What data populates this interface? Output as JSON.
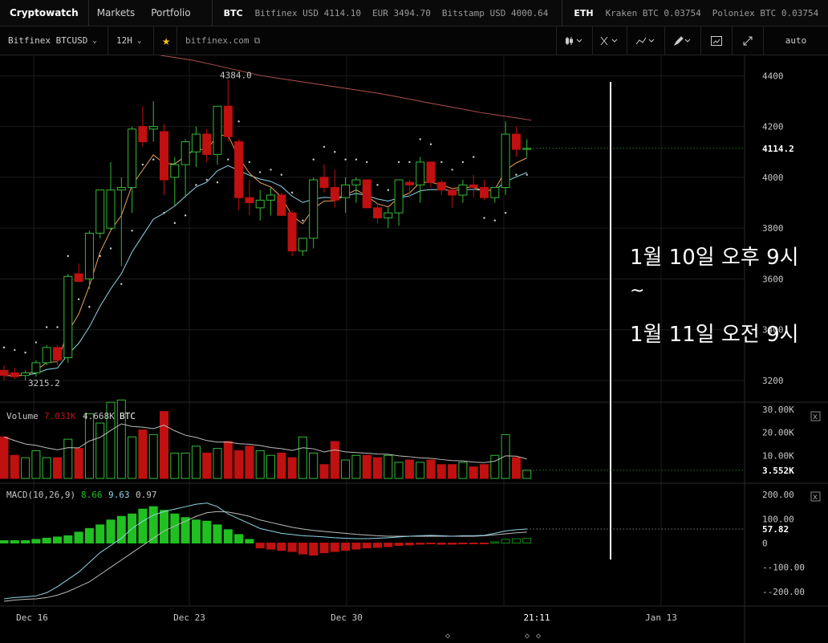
{
  "app": {
    "name": "Cryptowatch"
  },
  "nav": [
    "Markets",
    "Portfolio"
  ],
  "ticker": {
    "btc": {
      "label": "BTC",
      "items": [
        "Bitfinex USD 4114.10",
        "EUR 3494.70",
        "Bitstamp USD 4000.64"
      ]
    },
    "eth": {
      "label": "ETH",
      "items": [
        "Kraken BTC 0.03754",
        "Poloniex BTC 0.03754"
      ]
    }
  },
  "toolbar": {
    "market": "Bitfinex BTCUSD",
    "period": "12H",
    "star_icon": "star-icon",
    "link": "bitfinex.com",
    "icons": [
      "candlestick-icon",
      "crosshair-icon",
      "line-icon",
      "pencil-icon",
      "screenshot-icon",
      "fullscreen-icon"
    ],
    "scale": "auto"
  },
  "overlay": {
    "line1": "1월 10일 오후 9시",
    "line2": "~",
    "line3": "1월 11일 오전 9시"
  },
  "colors": {
    "up": "#35b935",
    "down": "#c01010",
    "ema_fast": "#e8a060",
    "ema_slow": "#8fd6e6",
    "sma": "#b05050",
    "dot": "#cfcfcf",
    "macd_up": "#20c020"
  },
  "chart_data": {
    "type": "candlestick",
    "market": "Bitfinex BTCUSD",
    "interval": "12H",
    "price_axis": {
      "ticks": [
        3200,
        3400,
        3600,
        3800,
        4000,
        4200,
        4400
      ],
      "range": [
        3140,
        4480
      ]
    },
    "last_price_label": "4114.2",
    "high_label": "4384.0",
    "low_label": "3215.2",
    "x_labels": [
      "Dec 16",
      "Dec 23",
      "Dec 30",
      "21:11",
      "Jan 13"
    ],
    "candles": [
      [
        3240,
        3260,
        3200,
        3220
      ],
      [
        3230,
        3250,
        3205,
        3215
      ],
      [
        3220,
        3240,
        3200,
        3230
      ],
      [
        3230,
        3280,
        3215,
        3270
      ],
      [
        3270,
        3340,
        3260,
        3330
      ],
      [
        3330,
        3340,
        3260,
        3280
      ],
      [
        3290,
        3620,
        3270,
        3610
      ],
      [
        3620,
        3660,
        3590,
        3590
      ],
      [
        3600,
        3790,
        3560,
        3780
      ],
      [
        3780,
        3950,
        3760,
        3950
      ],
      [
        3800,
        4060,
        3790,
        3950
      ],
      [
        3950,
        4000,
        3650,
        3960
      ],
      [
        3960,
        4200,
        3860,
        4190
      ],
      [
        4200,
        4280,
        4120,
        4140
      ],
      [
        4190,
        4300,
        4140,
        4200
      ],
      [
        4180,
        4210,
        3930,
        3990
      ],
      [
        4000,
        4080,
        3890,
        4050
      ],
      [
        4050,
        4150,
        3920,
        4140
      ],
      [
        4100,
        4200,
        4040,
        4170
      ],
      [
        4170,
        4190,
        4060,
        4090
      ],
      [
        4090,
        4180,
        4050,
        4280
      ],
      [
        4280,
        4384,
        4140,
        4160
      ],
      [
        4140,
        4150,
        3870,
        3920
      ],
      [
        3920,
        3990,
        3850,
        3900
      ],
      [
        3880,
        3950,
        3830,
        3910
      ],
      [
        3910,
        3960,
        3850,
        3930
      ],
      [
        3930,
        3940,
        3860,
        3850
      ],
      [
        3860,
        3870,
        3690,
        3710
      ],
      [
        3710,
        3760,
        3690,
        3760
      ],
      [
        3760,
        4000,
        3720,
        3990
      ],
      [
        4000,
        4050,
        3940,
        3960
      ],
      [
        3960,
        4030,
        3880,
        3910
      ],
      [
        3920,
        4000,
        3860,
        3970
      ],
      [
        3970,
        4000,
        3900,
        3990
      ],
      [
        3990,
        3950,
        3880,
        3880
      ],
      [
        3880,
        3900,
        3820,
        3840
      ],
      [
        3840,
        3880,
        3800,
        3860
      ],
      [
        3860,
        3980,
        3810,
        3990
      ],
      [
        3980,
        3990,
        3920,
        3970
      ],
      [
        3970,
        4080,
        3900,
        4060
      ],
      [
        4060,
        4060,
        3960,
        3980
      ],
      [
        3980,
        3990,
        3930,
        3950
      ],
      [
        3950,
        3960,
        3880,
        3930
      ],
      [
        3930,
        3990,
        3900,
        3970
      ],
      [
        3970,
        4010,
        3920,
        3960
      ],
      [
        3960,
        3990,
        3910,
        3920
      ],
      [
        3920,
        3960,
        3900,
        3960
      ],
      [
        3960,
        4220,
        3930,
        4170
      ],
      [
        4170,
        4200,
        4080,
        4110
      ],
      [
        4110,
        4150,
        4080,
        4114
      ]
    ],
    "sma_line": [
      4480,
      4470,
      4460,
      4445,
      4430,
      4415,
      4400,
      4390,
      4380,
      4370,
      4360,
      4350,
      4340,
      4330,
      4318,
      4305,
      4292,
      4280,
      4268,
      4255,
      4245,
      4235,
      4225
    ],
    "volume": {
      "title": "Volume",
      "value1": "7.031K",
      "value2": "4.668K",
      "unit": "BTC",
      "last": "3.552K",
      "axis_ticks": [
        "30.00K",
        "20.00K",
        "10.00K"
      ],
      "range": [
        0,
        32000
      ],
      "values": [
        18000,
        10000,
        9000,
        12000,
        9000,
        9000,
        17000,
        13000,
        28000,
        24000,
        33000,
        35000,
        18000,
        21000,
        19000,
        29000,
        11000,
        11000,
        14000,
        11000,
        13000,
        16000,
        12000,
        14000,
        12000,
        10000,
        11000,
        9000,
        18000,
        11000,
        6000,
        16000,
        8000,
        10000,
        10000,
        9000,
        10000,
        7000,
        8000,
        7000,
        8000,
        6000,
        6000,
        7000,
        5000,
        6000,
        10000,
        19000,
        9000,
        3552
      ]
    },
    "macd": {
      "title": "MACD(10,26,9)",
      "macd_value": "8.66",
      "signal_value": "9.63",
      "hist_value": "0.97",
      "last": "57.82",
      "axis_ticks": [
        "200.00",
        "100.00",
        "0",
        "-100.00",
        "-200.00"
      ],
      "range": [
        -260,
        240
      ],
      "hist": [
        10,
        10,
        10,
        15,
        20,
        25,
        30,
        45,
        60,
        75,
        95,
        110,
        120,
        140,
        150,
        135,
        120,
        105,
        95,
        90,
        75,
        55,
        35,
        15,
        -20,
        -25,
        -30,
        -35,
        -45,
        -50,
        -40,
        -35,
        -30,
        -25,
        -20,
        -18,
        -15,
        -10,
        -8,
        -5,
        -2,
        -5,
        -5,
        -3,
        -3,
        -2,
        5,
        15,
        18,
        20
      ],
      "macd_line": [
        -230,
        -225,
        -222,
        -218,
        -205,
        -180,
        -150,
        -120,
        -80,
        -40,
        -10,
        20,
        60,
        90,
        115,
        130,
        140,
        150,
        160,
        165,
        150,
        120,
        100,
        80,
        60,
        50,
        40,
        35,
        30,
        28,
        25,
        22,
        20,
        18,
        18,
        20,
        22,
        25,
        28,
        30,
        32,
        30,
        28,
        30,
        30,
        32,
        40,
        50,
        55,
        58
      ],
      "signal_line": [
        -240,
        -235,
        -232,
        -230,
        -225,
        -215,
        -200,
        -180,
        -160,
        -130,
        -100,
        -70,
        -40,
        -10,
        20,
        50,
        70,
        90,
        110,
        125,
        130,
        128,
        120,
        110,
        95,
        85,
        75,
        65,
        58,
        52,
        48,
        44,
        40,
        36,
        33,
        30,
        28,
        28,
        28,
        28,
        28,
        28,
        28,
        28,
        28,
        30,
        34,
        38,
        42,
        45
      ]
    }
  }
}
